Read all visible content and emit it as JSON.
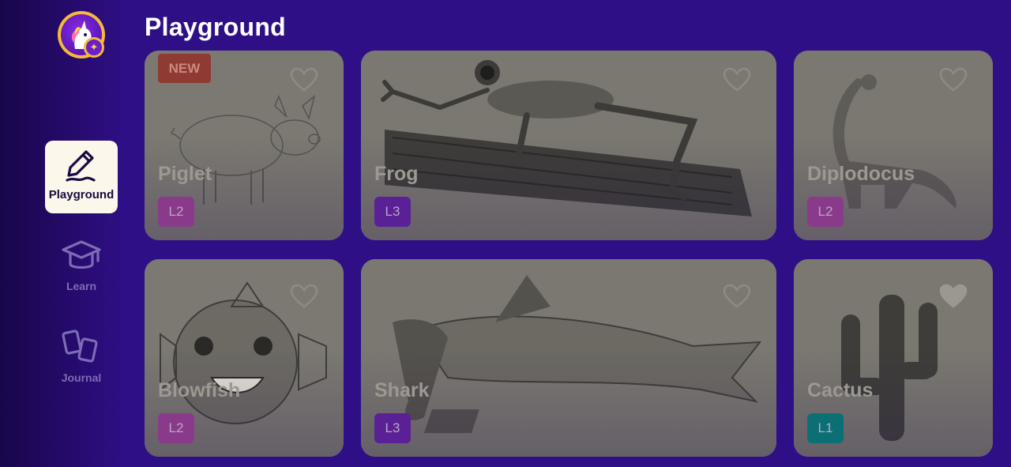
{
  "header": {
    "title": "Playground"
  },
  "sidebar": {
    "avatar_badge": "✦",
    "items": [
      {
        "label": "Playground",
        "icon": "pen-icon",
        "active": true
      },
      {
        "label": "Learn",
        "icon": "graduation-cap-icon",
        "active": false
      },
      {
        "label": "Journal",
        "icon": "journal-icon",
        "active": false
      }
    ]
  },
  "cards": [
    {
      "name": "Piglet",
      "level": "L2",
      "badge": "NEW",
      "favorited": false,
      "level_color": "#8a3a8a"
    },
    {
      "name": "Frog",
      "level": "L3",
      "favorited": false,
      "level_color": "#5a2196"
    },
    {
      "name": "Diplodocus",
      "level": "L2",
      "favorited": false,
      "level_color": "#8a3a8a"
    },
    {
      "name": "Blowfish",
      "level": "L2",
      "favorited": false,
      "level_color": "#8a3a8a"
    },
    {
      "name": "Shark",
      "level": "L3",
      "favorited": false,
      "level_color": "#5a2196"
    },
    {
      "name": "Cactus",
      "level": "L1",
      "favorited": true,
      "level_color": "#0c6f74"
    }
  ],
  "colors": {
    "background": "#2f0f86",
    "card_overlay": "#76746c",
    "active_nav": "#fbf7ea",
    "new_badge": "#8f3a32"
  }
}
